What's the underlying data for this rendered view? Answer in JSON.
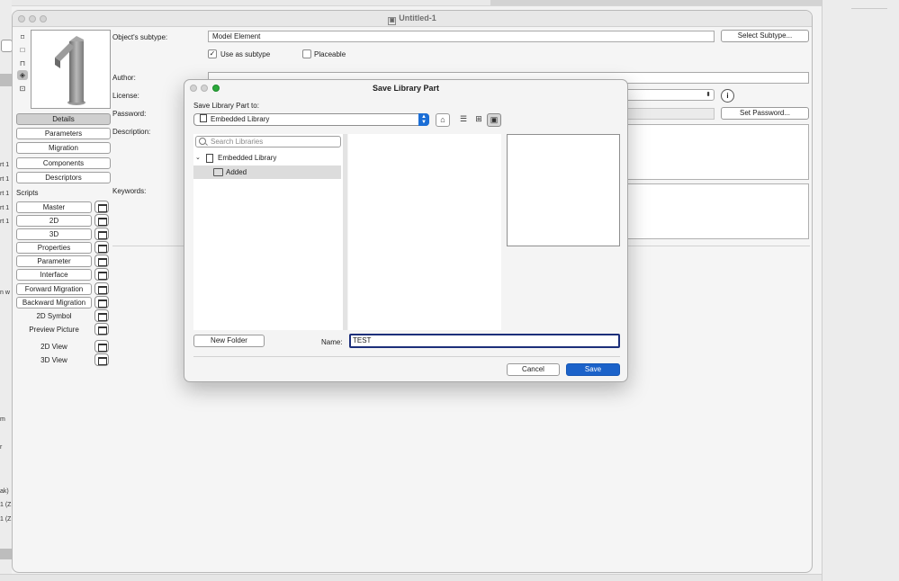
{
  "window": {
    "title": "Untitled-1"
  },
  "sidebar": {
    "tabs": [
      "Details",
      "Parameters",
      "Migration",
      "Components",
      "Descriptors"
    ],
    "scripts_heading": "Scripts",
    "scripts": [
      "Master",
      "2D",
      "3D",
      "Properties",
      "Parameter",
      "Interface",
      "Forward Migration",
      "Backward Migration"
    ],
    "extra": [
      "2D Symbol",
      "Preview Picture",
      "2D View",
      "3D View"
    ]
  },
  "details": {
    "subtype_label": "Object's subtype:",
    "subtype_value": "Model Element",
    "select_subtype_button": "Select Subtype...",
    "use_as_subtype_label": "Use as subtype",
    "use_as_subtype_checked": true,
    "placeable_label": "Placeable",
    "placeable_checked": false,
    "author_label": "Author:",
    "license_label": "License:",
    "password_label": "Password:",
    "set_password_button": "Set Password...",
    "description_label": "Description:",
    "keywords_label": "Keywords:"
  },
  "dialog": {
    "title": "Save Library Part",
    "save_to_label": "Save Library Part to:",
    "location_value": "Embedded Library",
    "search_placeholder": "Search Libraries",
    "tree": [
      {
        "label": "Embedded Library",
        "expanded": true
      },
      {
        "label": "Added",
        "selected": true
      }
    ],
    "new_folder_button": "New Folder",
    "name_label": "Name:",
    "name_value": "TEST",
    "cancel_button": "Cancel",
    "save_button": "Save"
  },
  "background_fragments": [
    "rt 1",
    "rt 1",
    "rt 1",
    "rt 1",
    "rt 1",
    "n w",
    "m",
    "r",
    "ak)",
    "1 (Z",
    "1 (Z"
  ],
  "colors": {
    "accent": "#1b62c9",
    "focus_ring": "#1c2f7a",
    "zoom_light": "#2aa83a"
  }
}
